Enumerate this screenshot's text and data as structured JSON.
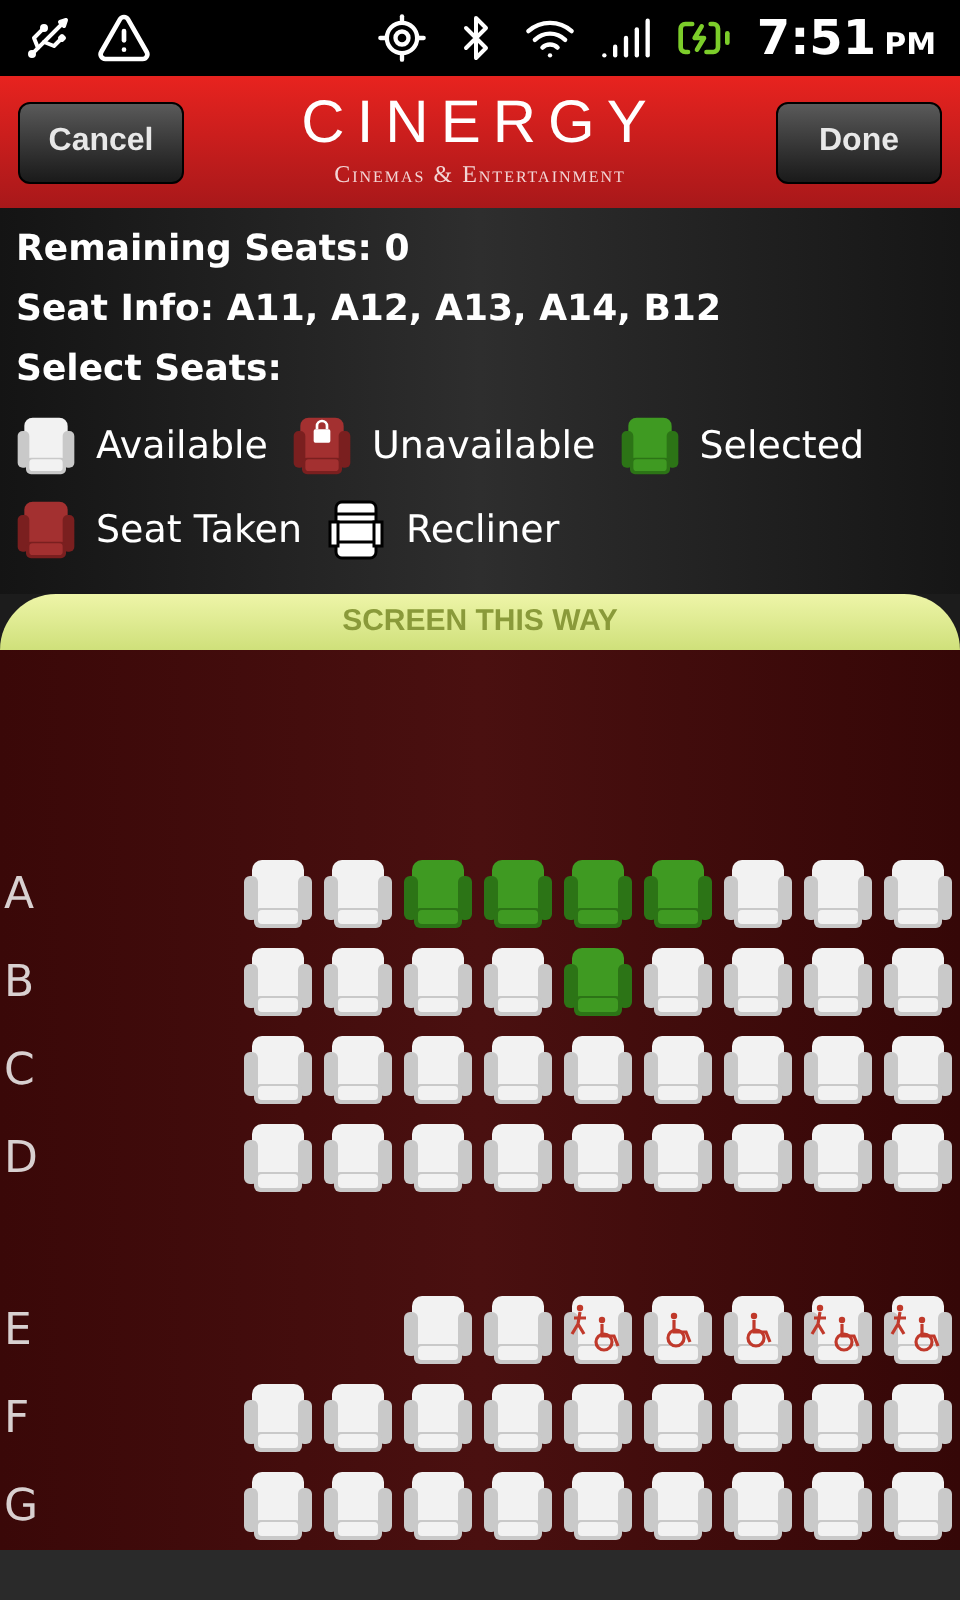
{
  "status_bar": {
    "time": "7:51",
    "ampm": "PM"
  },
  "header": {
    "cancel": "Cancel",
    "logo": "CINERGY",
    "tagline": "Cinemas & Entertainment",
    "done": "Done"
  },
  "info": {
    "remaining": "Remaining Seats: 0",
    "seat_info": "Seat Info: A11, A12, A13, A14, B12",
    "select": "Select Seats:"
  },
  "legend": [
    {
      "kind": "available",
      "label": "Available"
    },
    {
      "kind": "unavailable",
      "label": "Unavailable"
    },
    {
      "kind": "selected",
      "label": "Selected"
    },
    {
      "kind": "taken",
      "label": "Seat Taken"
    },
    {
      "kind": "recliner",
      "label": "Recliner"
    }
  ],
  "screen_banner": "SCREEN THIS WAY",
  "rows": [
    {
      "label": "A",
      "seats": [
        {
          "kind": "seat",
          "selected": false
        },
        {
          "kind": "seat",
          "selected": false
        },
        {
          "kind": "seat",
          "selected": true
        },
        {
          "kind": "seat",
          "selected": true
        },
        {
          "kind": "seat",
          "selected": true
        },
        {
          "kind": "seat",
          "selected": true
        },
        {
          "kind": "seat",
          "selected": false
        },
        {
          "kind": "seat",
          "selected": false
        },
        {
          "kind": "seat",
          "selected": false
        }
      ]
    },
    {
      "label": "B",
      "seats": [
        {
          "kind": "seat",
          "selected": false
        },
        {
          "kind": "seat",
          "selected": false
        },
        {
          "kind": "seat",
          "selected": false
        },
        {
          "kind": "seat",
          "selected": false
        },
        {
          "kind": "seat",
          "selected": true
        },
        {
          "kind": "seat",
          "selected": false
        },
        {
          "kind": "seat",
          "selected": false
        },
        {
          "kind": "seat",
          "selected": false
        },
        {
          "kind": "seat",
          "selected": false
        }
      ]
    },
    {
      "label": "C",
      "seats": [
        {
          "kind": "seat",
          "selected": false
        },
        {
          "kind": "seat",
          "selected": false
        },
        {
          "kind": "seat",
          "selected": false
        },
        {
          "kind": "seat",
          "selected": false
        },
        {
          "kind": "seat",
          "selected": false
        },
        {
          "kind": "seat",
          "selected": false
        },
        {
          "kind": "seat",
          "selected": false
        },
        {
          "kind": "seat",
          "selected": false
        },
        {
          "kind": "seat",
          "selected": false
        }
      ]
    },
    {
      "label": "D",
      "seats": [
        {
          "kind": "seat",
          "selected": false
        },
        {
          "kind": "seat",
          "selected": false
        },
        {
          "kind": "seat",
          "selected": false
        },
        {
          "kind": "seat",
          "selected": false
        },
        {
          "kind": "seat",
          "selected": false
        },
        {
          "kind": "seat",
          "selected": false
        },
        {
          "kind": "seat",
          "selected": false
        },
        {
          "kind": "seat",
          "selected": false
        },
        {
          "kind": "seat",
          "selected": false
        }
      ]
    },
    {
      "kind": "aisle"
    },
    {
      "label": "E",
      "seats": [
        {
          "kind": "gap"
        },
        {
          "kind": "gap"
        },
        {
          "kind": "seat",
          "selected": false
        },
        {
          "kind": "seat",
          "selected": false
        },
        {
          "kind": "companion"
        },
        {
          "kind": "wheelchair"
        },
        {
          "kind": "wheelchair"
        },
        {
          "kind": "companion"
        },
        {
          "kind": "companion"
        }
      ]
    },
    {
      "label": "F",
      "seats": [
        {
          "kind": "seat",
          "selected": false
        },
        {
          "kind": "seat",
          "selected": false
        },
        {
          "kind": "seat",
          "selected": false
        },
        {
          "kind": "seat",
          "selected": false
        },
        {
          "kind": "seat",
          "selected": false
        },
        {
          "kind": "seat",
          "selected": false
        },
        {
          "kind": "seat",
          "selected": false
        },
        {
          "kind": "seat",
          "selected": false
        },
        {
          "kind": "seat",
          "selected": false
        }
      ]
    },
    {
      "label": "G",
      "seats": [
        {
          "kind": "seat",
          "selected": false
        },
        {
          "kind": "seat",
          "selected": false
        },
        {
          "kind": "seat",
          "selected": false
        },
        {
          "kind": "seat",
          "selected": false
        },
        {
          "kind": "seat",
          "selected": false
        },
        {
          "kind": "seat",
          "selected": false
        },
        {
          "kind": "seat",
          "selected": false
        },
        {
          "kind": "seat",
          "selected": false
        },
        {
          "kind": "seat",
          "selected": false
        }
      ]
    }
  ]
}
